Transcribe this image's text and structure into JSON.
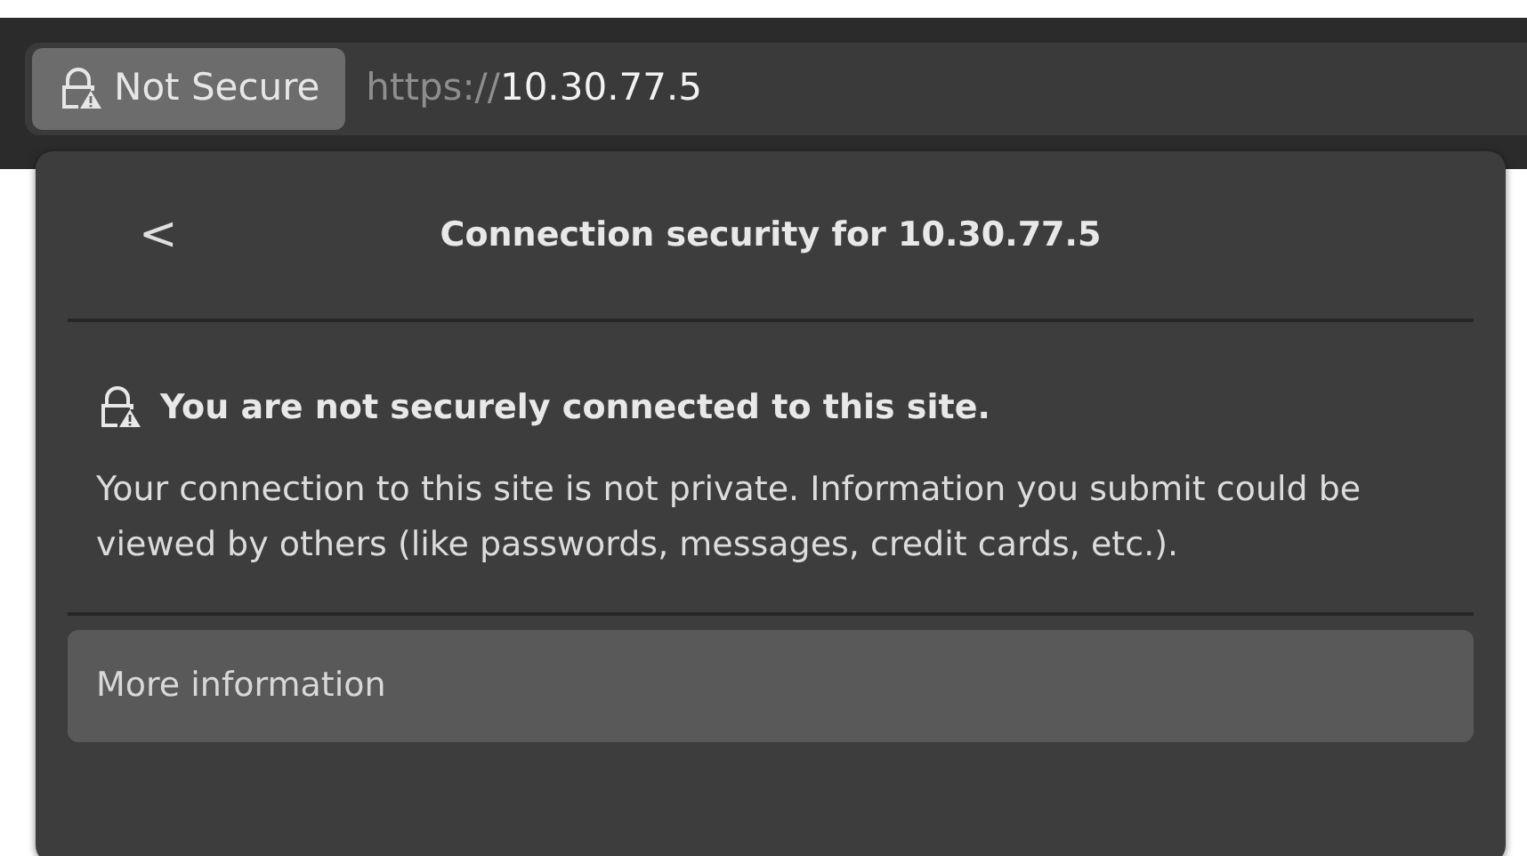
{
  "address_bar": {
    "security_chip": "Not Secure",
    "url_scheme": "https://",
    "url_host": "10.30.77.5"
  },
  "popover": {
    "back": "<",
    "title": "Connection security for 10.30.77.5",
    "warning": "You are not securely connected to this site.",
    "description": "Your connection to this site is not private. Information you submit could be viewed by others (like passwords, messages, credit cards, etc.).",
    "more_button": "More information"
  }
}
